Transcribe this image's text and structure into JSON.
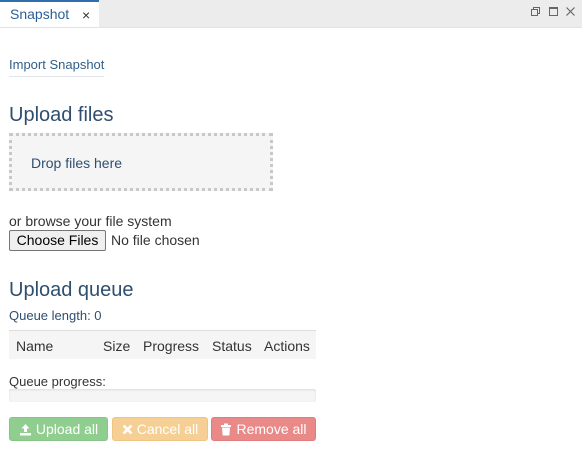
{
  "tab": {
    "title": "Snapshot",
    "close_glyph": "×"
  },
  "window_controls": [
    "restore-icon",
    "maximize-icon",
    "close-icon"
  ],
  "import_link": "Import Snapshot",
  "upload_files": {
    "heading": "Upload files",
    "dropzone_text": "Drop files here",
    "browse_text": "or browse your file system",
    "choose_button": "Choose Files",
    "no_file_text": "No file chosen"
  },
  "upload_queue": {
    "heading": "Upload queue",
    "queue_length": "Queue length: 0",
    "columns": [
      "Name",
      "Size",
      "Progress",
      "Status",
      "Actions"
    ],
    "progress_label": "Queue progress:",
    "progress_percent": 0
  },
  "actions": {
    "upload_all": "Upload all",
    "cancel_all": "Cancel all",
    "remove_all": "Remove all"
  },
  "colors": {
    "success": "#8fce8f",
    "warning": "#f6cf94",
    "danger": "#e98a88",
    "heading": "#2f4f6f",
    "tab_accent": "#2f6fb0"
  }
}
